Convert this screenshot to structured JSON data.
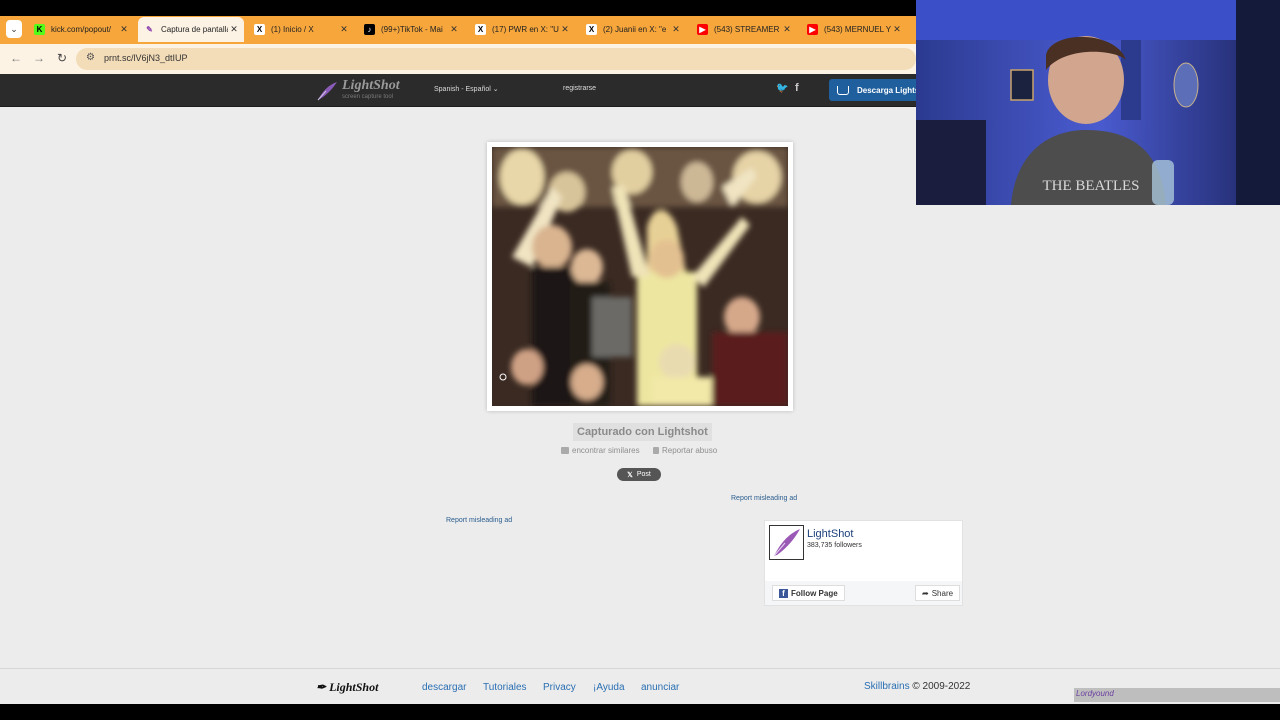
{
  "browser": {
    "tabs": [
      {
        "label": "kick.com/popout/",
        "favicon": "kick-icon",
        "color": "#53fc18",
        "active": false
      },
      {
        "label": "Captura de pantalla",
        "favicon": "lightshot-pen-icon",
        "color": "#8e44ad",
        "active": true
      },
      {
        "label": "(1) Inicio / X",
        "favicon": "x-icon",
        "color": "#000000",
        "active": false
      },
      {
        "label": "(99+)TikTok - Mai",
        "favicon": "tiktok-icon",
        "color": "#000000",
        "active": false
      },
      {
        "label": "(17) PWR en X: \"U",
        "favicon": "x-icon",
        "color": "#000000",
        "active": false
      },
      {
        "label": "(2) Juanii en X: \"e",
        "favicon": "x-icon",
        "color": "#000000",
        "active": false
      },
      {
        "label": "(543) STREAMER",
        "favicon": "youtube-icon",
        "color": "#ff0000",
        "active": false
      },
      {
        "label": "(543) MERNUEL Y",
        "favicon": "youtube-icon",
        "color": "#ff0000",
        "active": false
      }
    ],
    "url": "prnt.sc/lV6jN3_dtIUP"
  },
  "header": {
    "logo": "LightShot",
    "logo_sub": "screen capture tool",
    "language": "Spanish - Español",
    "register": "registrarse",
    "download": "Descarga Lightshot"
  },
  "main": {
    "caption": "Capturado con Lightshot",
    "find_similar": "encontrar similares",
    "report_abuse": "Reportar abuso",
    "post_button": "Post",
    "misleading_ad_1": "Report misleading ad",
    "misleading_ad_2": "Report misleading ad"
  },
  "facebook": {
    "page_name": "LightShot",
    "followers": "383,735 followers",
    "follow": "Follow Page",
    "share": "Share"
  },
  "footer": {
    "logo": "LightShot",
    "links": [
      "descargar",
      "Tutoriales",
      "Privacy",
      "¡Ayuda",
      "anunciar"
    ],
    "company": "Skillbrains",
    "copyright": "© 2009-2022"
  },
  "overlay": {
    "shirt_text": "THE BEATLES",
    "watermark": "Lordyound"
  }
}
